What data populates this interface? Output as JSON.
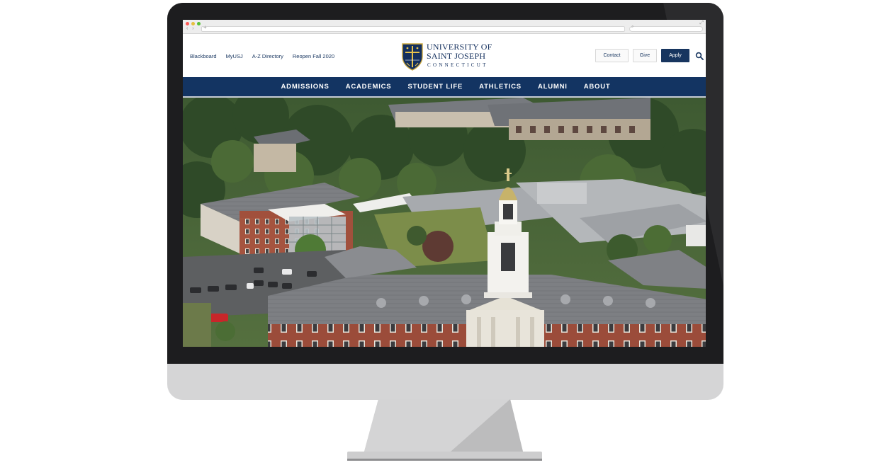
{
  "site": {
    "utility_links": [
      "Blackboard",
      "MyUSJ",
      "A-Z Directory",
      "Reopen Fall 2020"
    ],
    "logo": {
      "line1": "UNIVERSITY OF",
      "line2": "SAINT JOSEPH",
      "line3": "CONNECTICUT"
    },
    "actions": {
      "contact_label": "Contact",
      "give_label": "Give",
      "apply_label": "Apply"
    },
    "nav": [
      "ADMISSIONS",
      "ACADEMICS",
      "STUDENT LIFE",
      "ATHLETICS",
      "ALUMNI",
      "ABOUT"
    ]
  },
  "icons": {
    "search": "search-icon",
    "crest": "crest-icon",
    "back": "back-arrow-icon",
    "forward": "forward-arrow-icon",
    "expand": "expand-icon"
  },
  "colors": {
    "brand_navy": "#133462",
    "bezel": "#1d1d1f",
    "chin": "#d5d5d6",
    "stand": "#c9c9ca"
  }
}
